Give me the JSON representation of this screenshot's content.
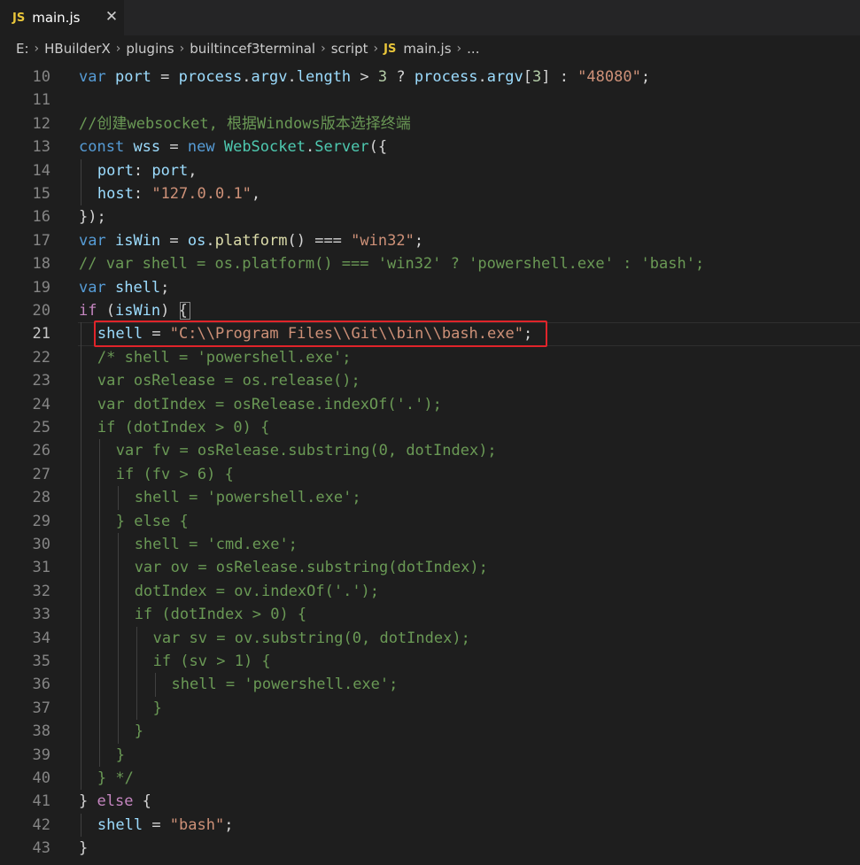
{
  "tab": {
    "badge": "JS",
    "filename": "main.js",
    "close_glyph": "✕"
  },
  "breadcrumb": {
    "items": [
      "E:",
      "HBuilderX",
      "plugins",
      "builtincef3terminal",
      "script"
    ],
    "file_badge": "JS",
    "file": "main.js",
    "trailing": "..."
  },
  "editor": {
    "current_line": 21,
    "lines": [
      {
        "num": 10,
        "indent": 0,
        "tokens": [
          [
            "k",
            "var"
          ],
          [
            "p",
            " "
          ],
          [
            "v",
            "port"
          ],
          [
            "p",
            " = "
          ],
          [
            "v",
            "process"
          ],
          [
            "p",
            "."
          ],
          [
            "v",
            "argv"
          ],
          [
            "p",
            "."
          ],
          [
            "v",
            "length"
          ],
          [
            "p",
            " > "
          ],
          [
            "n",
            "3"
          ],
          [
            "p",
            " ? "
          ],
          [
            "v",
            "process"
          ],
          [
            "p",
            "."
          ],
          [
            "v",
            "argv"
          ],
          [
            "p",
            "["
          ],
          [
            "n",
            "3"
          ],
          [
            "p",
            "] : "
          ],
          [
            "s",
            "\"48080\""
          ],
          [
            "p",
            ";"
          ]
        ]
      },
      {
        "num": 11,
        "indent": 0,
        "tokens": []
      },
      {
        "num": 12,
        "indent": 0,
        "tokens": [
          [
            "cm",
            "//创建websocket, 根据Windows版本选择终端"
          ]
        ]
      },
      {
        "num": 13,
        "indent": 0,
        "tokens": [
          [
            "k",
            "const"
          ],
          [
            "p",
            " "
          ],
          [
            "v",
            "wss"
          ],
          [
            "p",
            " = "
          ],
          [
            "k",
            "new"
          ],
          [
            "p",
            " "
          ],
          [
            "cls",
            "WebSocket"
          ],
          [
            "p",
            "."
          ],
          [
            "cls",
            "Server"
          ],
          [
            "p",
            "({"
          ]
        ]
      },
      {
        "num": 14,
        "indent": 1,
        "tokens": [
          [
            "v",
            "port"
          ],
          [
            "p",
            ": "
          ],
          [
            "v",
            "port"
          ],
          [
            "p",
            ","
          ]
        ]
      },
      {
        "num": 15,
        "indent": 1,
        "tokens": [
          [
            "v",
            "host"
          ],
          [
            "p",
            ": "
          ],
          [
            "s",
            "\"127.0.0.1\""
          ],
          [
            "p",
            ","
          ]
        ]
      },
      {
        "num": 16,
        "indent": 0,
        "tokens": [
          [
            "p",
            "});"
          ]
        ]
      },
      {
        "num": 17,
        "indent": 0,
        "tokens": [
          [
            "k",
            "var"
          ],
          [
            "p",
            " "
          ],
          [
            "v",
            "isWin"
          ],
          [
            "p",
            " = "
          ],
          [
            "v",
            "os"
          ],
          [
            "p",
            "."
          ],
          [
            "f",
            "platform"
          ],
          [
            "p",
            "() === "
          ],
          [
            "s",
            "\"win32\""
          ],
          [
            "p",
            ";"
          ]
        ]
      },
      {
        "num": 18,
        "indent": 0,
        "tokens": [
          [
            "cm",
            "// var shell = os.platform() === 'win32' ? 'powershell.exe' : 'bash';"
          ]
        ]
      },
      {
        "num": 19,
        "indent": 0,
        "tokens": [
          [
            "k",
            "var"
          ],
          [
            "p",
            " "
          ],
          [
            "v",
            "shell"
          ],
          [
            "p",
            ";"
          ]
        ]
      },
      {
        "num": 20,
        "indent": 0,
        "tokens": [
          [
            "c",
            "if"
          ],
          [
            "p",
            " ("
          ],
          [
            "v",
            "isWin"
          ],
          [
            "p",
            ") {"
          ]
        ]
      },
      {
        "num": 21,
        "indent": 1,
        "tokens": [
          [
            "v",
            "shell"
          ],
          [
            "p",
            " = "
          ],
          [
            "s",
            "\"C:\\\\Program Files\\\\Git\\\\bin\\\\bash.exe\""
          ],
          [
            "p",
            ";"
          ]
        ]
      },
      {
        "num": 22,
        "indent": 1,
        "tokens": [
          [
            "cm",
            "/* shell = 'powershell.exe';"
          ]
        ]
      },
      {
        "num": 23,
        "indent": 1,
        "tokens": [
          [
            "cm",
            "var osRelease = os.release();"
          ]
        ]
      },
      {
        "num": 24,
        "indent": 1,
        "tokens": [
          [
            "cm",
            "var dotIndex = osRelease.indexOf('.');"
          ]
        ]
      },
      {
        "num": 25,
        "indent": 1,
        "tokens": [
          [
            "cm",
            "if (dotIndex > 0) {"
          ]
        ]
      },
      {
        "num": 26,
        "indent": 2,
        "tokens": [
          [
            "cm",
            "var fv = osRelease.substring(0, dotIndex);"
          ]
        ]
      },
      {
        "num": 27,
        "indent": 2,
        "tokens": [
          [
            "cm",
            "if (fv > 6) {"
          ]
        ]
      },
      {
        "num": 28,
        "indent": 3,
        "tokens": [
          [
            "cm",
            "shell = 'powershell.exe';"
          ]
        ]
      },
      {
        "num": 29,
        "indent": 2,
        "tokens": [
          [
            "cm",
            "} else {"
          ]
        ]
      },
      {
        "num": 30,
        "indent": 3,
        "tokens": [
          [
            "cm",
            "shell = 'cmd.exe';"
          ]
        ]
      },
      {
        "num": 31,
        "indent": 3,
        "tokens": [
          [
            "cm",
            "var ov = osRelease.substring(dotIndex);"
          ]
        ]
      },
      {
        "num": 32,
        "indent": 3,
        "tokens": [
          [
            "cm",
            "dotIndex = ov.indexOf('.');"
          ]
        ]
      },
      {
        "num": 33,
        "indent": 3,
        "tokens": [
          [
            "cm",
            "if (dotIndex > 0) {"
          ]
        ]
      },
      {
        "num": 34,
        "indent": 4,
        "tokens": [
          [
            "cm",
            "var sv = ov.substring(0, dotIndex);"
          ]
        ]
      },
      {
        "num": 35,
        "indent": 4,
        "tokens": [
          [
            "cm",
            "if (sv > 1) {"
          ]
        ]
      },
      {
        "num": 36,
        "indent": 5,
        "tokens": [
          [
            "cm",
            "shell = 'powershell.exe';"
          ]
        ]
      },
      {
        "num": 37,
        "indent": 4,
        "tokens": [
          [
            "cm",
            "}"
          ]
        ]
      },
      {
        "num": 38,
        "indent": 3,
        "tokens": [
          [
            "cm",
            "}"
          ]
        ]
      },
      {
        "num": 39,
        "indent": 2,
        "tokens": [
          [
            "cm",
            "}"
          ]
        ]
      },
      {
        "num": 40,
        "indent": 1,
        "tokens": [
          [
            "cm",
            "} */"
          ]
        ]
      },
      {
        "num": 41,
        "indent": 0,
        "tokens": [
          [
            "p",
            "} "
          ],
          [
            "c",
            "else"
          ],
          [
            "p",
            " {"
          ]
        ]
      },
      {
        "num": 42,
        "indent": 1,
        "tokens": [
          [
            "v",
            "shell"
          ],
          [
            "p",
            " = "
          ],
          [
            "s",
            "\"bash\""
          ],
          [
            "p",
            ";"
          ]
        ]
      },
      {
        "num": 43,
        "indent": 0,
        "tokens": [
          [
            "p",
            "}"
          ]
        ]
      }
    ]
  }
}
